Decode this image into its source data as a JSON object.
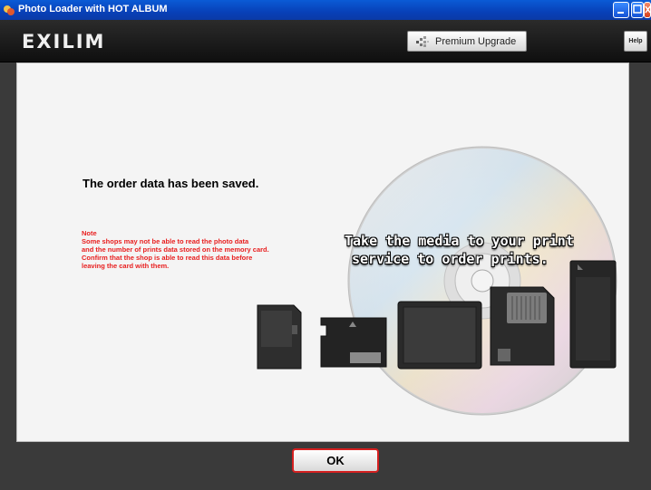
{
  "window": {
    "title": "Photo Loader with HOT ALBUM"
  },
  "toolbar": {
    "logo": "EXILIM",
    "premium_label": "Premium Upgrade",
    "help_label": "Help"
  },
  "main": {
    "saved_message": "The order data has been saved.",
    "note_lines": [
      "Note",
      "Some shops may not be able to read the photo data",
      "and the number of prints data stored on the memory card.",
      "Confirm that the shop is able to read this data before",
      "leaving the card with them."
    ],
    "media_lines": [
      "Take the media to your print",
      "service to order prints."
    ]
  },
  "footer": {
    "ok_label": "OK"
  },
  "colors": {
    "note": "#e82020",
    "ok_border": "#d52020",
    "titlebar": "#0840b8"
  }
}
